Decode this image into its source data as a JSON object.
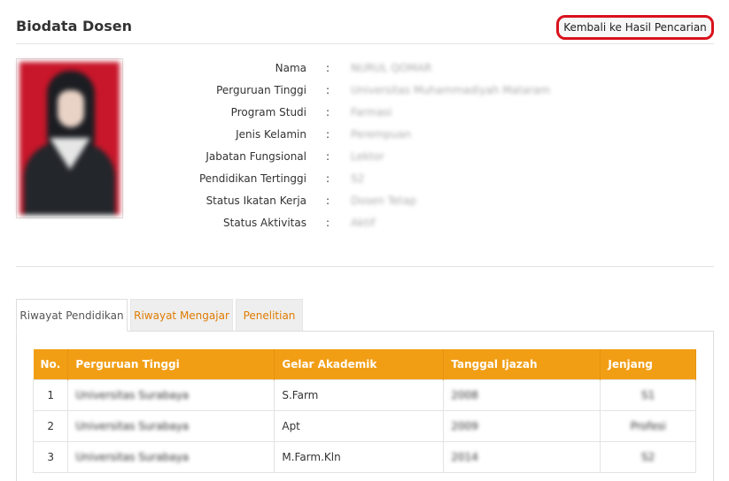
{
  "header": {
    "title": "Biodata Dosen",
    "back_button": "Kembali ke Hasil Pencarian"
  },
  "photo": {
    "description_icon": "profile-photo"
  },
  "biodata": [
    {
      "label": "Nama",
      "value": "NURUL QOMAR"
    },
    {
      "label": "Perguruan Tinggi",
      "value": "Universitas Muhammadiyah Mataram"
    },
    {
      "label": "Program Studi",
      "value": "Farmasi"
    },
    {
      "label": "Jenis Kelamin",
      "value": "Perempuan"
    },
    {
      "label": "Jabatan Fungsional",
      "value": "Lektor"
    },
    {
      "label": "Pendidikan Tertinggi",
      "value": "S2"
    },
    {
      "label": "Status Ikatan Kerja",
      "value": "Dosen Tetap"
    },
    {
      "label": "Status Aktivitas",
      "value": "Aktif"
    }
  ],
  "colon": ":",
  "tabs": [
    {
      "label": "Riwayat Pendidikan",
      "active": true
    },
    {
      "label": "Riwayat Mengajar",
      "active": false
    },
    {
      "label": "Penelitian",
      "active": false
    }
  ],
  "table": {
    "headers": [
      "No.",
      "Perguruan Tinggi",
      "Gelar Akademik",
      "Tanggal Ijazah",
      "Jenjang"
    ],
    "rows": [
      [
        "1",
        "Universitas Surabaya",
        "S.Farm",
        "2008",
        "S1"
      ],
      [
        "2",
        "Universitas Surabaya",
        "Apt",
        "2009",
        "Profesi"
      ],
      [
        "3",
        "Universitas Surabaya",
        "M.Farm.Kln",
        "2014",
        "S2"
      ]
    ]
  },
  "colors": {
    "accent": "#f29e15",
    "tab_link": "#e07b00",
    "highlight": "#d9121c"
  }
}
